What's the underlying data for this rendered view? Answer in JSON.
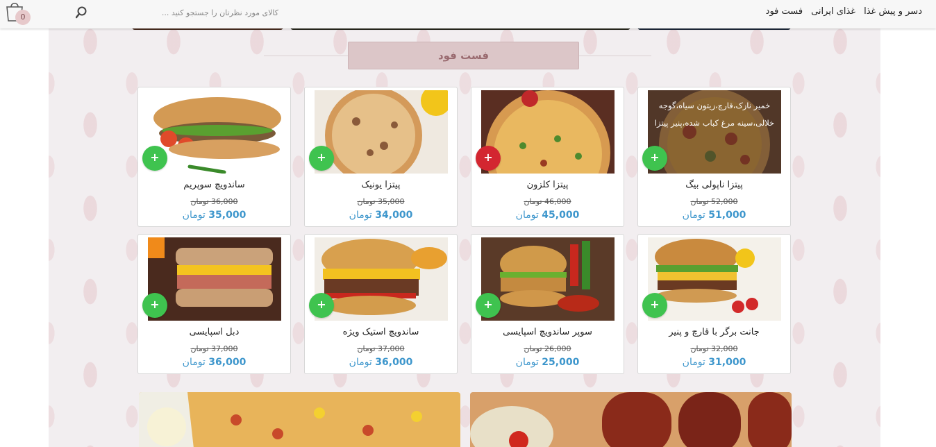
{
  "header": {
    "nav": [
      "فست فود",
      "غذای ایرانی",
      "دسر و پیش غذا"
    ],
    "search_placeholder": "کالای مورد نظرتان را جستجو کنید ...",
    "cart_count": "0"
  },
  "section": {
    "title": "فست فود"
  },
  "currency": "تومان",
  "products": [
    {
      "name": "پیتزا ناپولی بیگ",
      "old_price": "52,000",
      "price": "51,000",
      "description": "خمیر نازک،قارچ،زیتون سیاه،گوجه خلالی،سینه مرغ کباب شده،پنیر پیتزا",
      "button": "red-icon-no",
      "add_label": "+"
    },
    {
      "name": "پیتزا کلزون",
      "old_price": "46,000",
      "price": "45,000",
      "add_label": "+"
    },
    {
      "name": "پیتزا یونیک",
      "old_price": "35,000",
      "price": "34,000",
      "add_label": "+"
    },
    {
      "name": "ساندویچ سوپریم",
      "old_price": "36,000",
      "price": "35,000",
      "add_label": "+"
    },
    {
      "name": "جانت برگر با قارچ و پنیر",
      "old_price": "32,000",
      "price": "31,000",
      "add_label": "+"
    },
    {
      "name": "سوپر ساندویچ اسپایسی",
      "old_price": "26,000",
      "price": "25,000",
      "add_label": "+"
    },
    {
      "name": "ساندویچ استیک ویژه",
      "old_price": "37,000",
      "price": "36,000",
      "add_label": "+"
    },
    {
      "name": "دبل اسپایسی",
      "old_price": "37,000",
      "price": "36,000",
      "add_label": "+"
    }
  ],
  "colors": {
    "accent_price": "#3d96cc",
    "add_green": "#3fc34f",
    "add_red": "#d32630",
    "section_bg": "#dcc6c8"
  },
  "icons": {
    "search": "search-icon",
    "cart": "shopping-bag-icon",
    "add": "plus-icon"
  }
}
